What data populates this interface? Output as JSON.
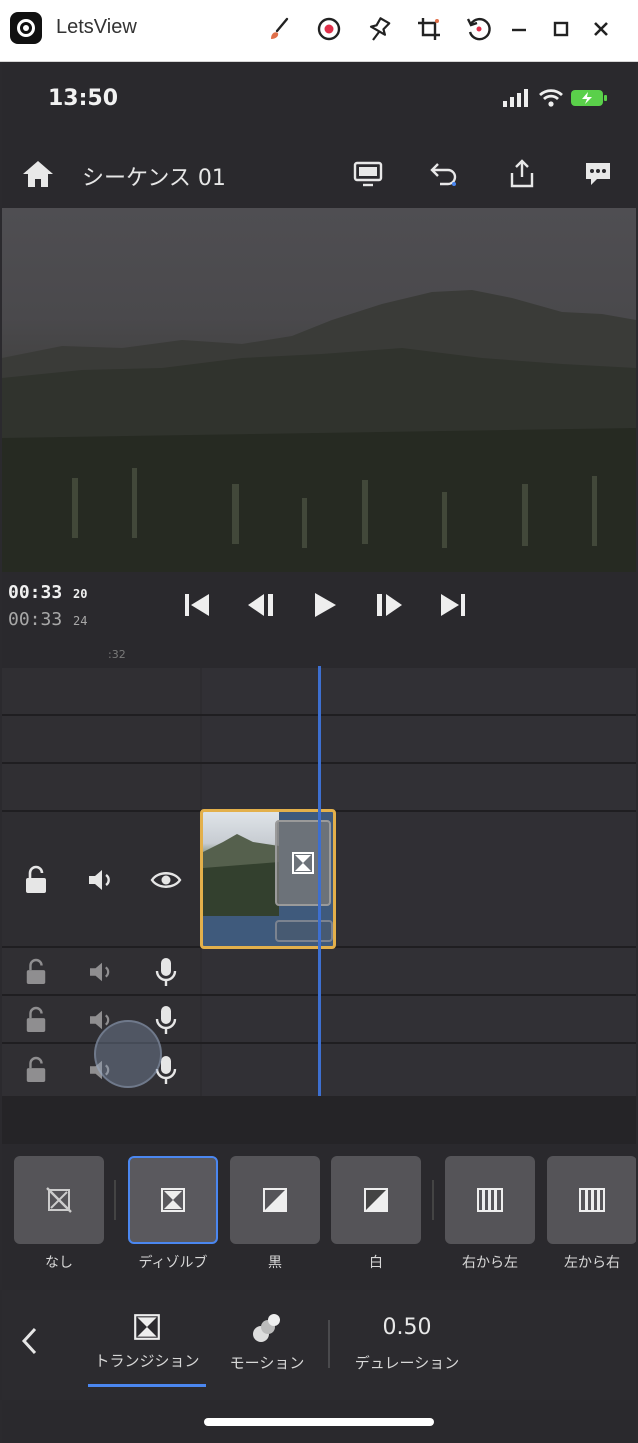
{
  "host": {
    "title": "LetsView"
  },
  "status": {
    "time": "13:50"
  },
  "nav": {
    "sequence_title": "シーケンス 01"
  },
  "timecode": {
    "current_main": "00:33",
    "current_frames": "20",
    "total_main": "00:33",
    "total_frames": "24"
  },
  "ruler": {
    "label": ":32"
  },
  "transitions": [
    {
      "label": "なし",
      "icon": "none-transition-icon"
    },
    {
      "label": "ディゾルブ",
      "icon": "dissolve-icon",
      "selected": true
    },
    {
      "label": "黒",
      "icon": "dip-to-black-icon"
    },
    {
      "label": "白",
      "icon": "dip-to-white-icon"
    },
    {
      "label": "右から左",
      "icon": "wipe-right-to-left-icon"
    },
    {
      "label": "左から右",
      "icon": "wipe-left-to-right-icon"
    }
  ],
  "tabs": {
    "transition": "トランジション",
    "motion": "モーション",
    "duration_label": "デュレーション",
    "duration_value": "0.50"
  },
  "colors": {
    "accent": "#4b87f0",
    "clip_border": "#e3b04b",
    "playhead": "#3d6fd0",
    "battery": "#5ad04a"
  }
}
